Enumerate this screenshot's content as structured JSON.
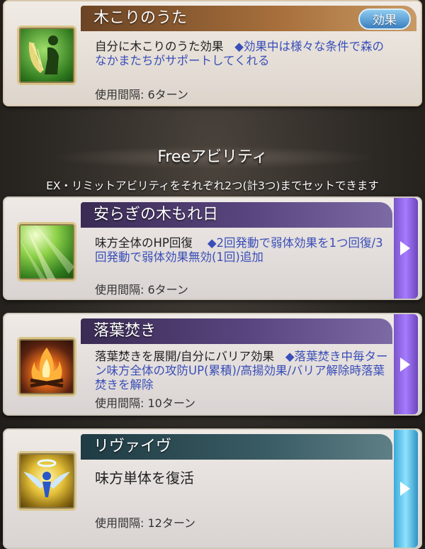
{
  "support": {
    "title": "木こりのうた",
    "effect_button": "効果",
    "desc_plain": "自分に木こりのうた効果",
    "desc_note": "◆効果中は様々な条件で森のなかまたちがサポートしてくれる",
    "interval": "使用間隔: 6ターン",
    "icon": "harp-player-icon"
  },
  "free_section": {
    "title": "Freeアビリティ",
    "subtitle": "EX・リミットアビリティをそれぞれ2つ(計3つ)までセットできます"
  },
  "abilities": [
    {
      "title": "安らぎの木もれ日",
      "desc_plain": "味方全体のHP回復",
      "desc_note": "◆2回発動で弱体効果を1つ回復/3回発動で弱体効果無効(1回)追加",
      "interval": "使用間隔: 6ターン",
      "icon": "sunbeam-forest-icon",
      "arrow": "purple"
    },
    {
      "title": "落葉焚き",
      "desc_plain": "落葉焚きを展開/自分にバリア効果",
      "desc_note": "◆落葉焚き中毎ターン味方全体の攻防UP(累積)/高揚効果/バリア解除時落葉焚きを解除",
      "interval": "使用間隔: 10ターン",
      "icon": "bonfire-icon",
      "arrow": "purple"
    },
    {
      "title": "リヴァイヴ",
      "desc_plain": "味方単体を復活",
      "desc_note": "",
      "interval": "使用間隔: 12ターン",
      "icon": "revive-halo-icon",
      "arrow": "blue"
    }
  ]
}
